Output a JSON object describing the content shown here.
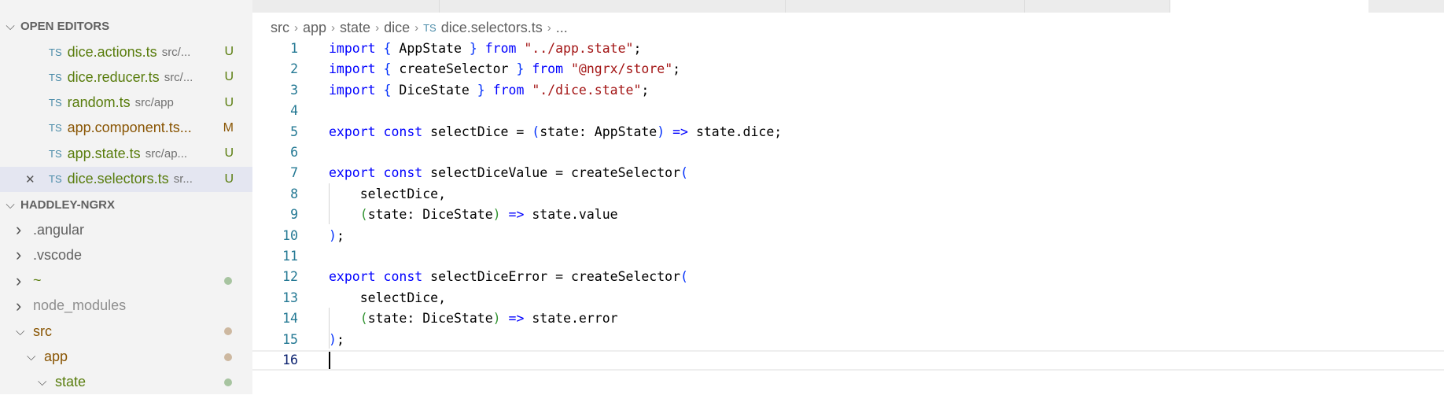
{
  "sidebar": {
    "open_editors_title": "OPEN EDITORS",
    "open_editors": [
      {
        "icon": "TS",
        "name": "dice.actions.ts",
        "desc": "src/...",
        "badge": "U",
        "color": "#587c0c"
      },
      {
        "icon": "TS",
        "name": "dice.reducer.ts",
        "desc": "src/...",
        "badge": "U",
        "color": "#587c0c"
      },
      {
        "icon": "TS",
        "name": "random.ts",
        "desc": "src/app",
        "badge": "U",
        "color": "#587c0c"
      },
      {
        "icon": "TS",
        "name": "app.component.ts...",
        "desc": "",
        "badge": "M",
        "color": "#895503"
      },
      {
        "icon": "TS",
        "name": "app.state.ts",
        "desc": "src/ap...",
        "badge": "U",
        "color": "#587c0c"
      },
      {
        "icon": "TS",
        "name": "dice.selectors.ts",
        "desc": "sr...",
        "badge": "U",
        "color": "#587c0c"
      }
    ],
    "project_title": "HADDLEY-NGRX",
    "tree": [
      {
        "name": ".angular",
        "expanded": false,
        "color": "#616161"
      },
      {
        "name": ".vscode",
        "expanded": false,
        "color": "#616161"
      },
      {
        "name": "~",
        "expanded": false,
        "color": "#587c0c",
        "dot": "#a7c4a0"
      },
      {
        "name": "node_modules",
        "expanded": false,
        "color": "#8e8e8e"
      },
      {
        "name": "src",
        "expanded": true,
        "color": "#895503",
        "dot": "#cdb8a0"
      },
      {
        "name": "app",
        "expanded": true,
        "color": "#895503",
        "dot": "#cdb8a0"
      },
      {
        "name": "state",
        "expanded": true,
        "color": "#587c0c",
        "dot": "#a7c4a0"
      }
    ]
  },
  "breadcrumb": [
    "src",
    "app",
    "state",
    "dice"
  ],
  "breadcrumb_file": "dice.selectors.ts",
  "breadcrumb_more": "...",
  "breadcrumb_file_icon": "TS",
  "code": [
    [
      [
        "import ",
        "k"
      ],
      [
        "{ ",
        "b1"
      ],
      [
        "AppState ",
        "t"
      ],
      [
        "} ",
        "b1"
      ],
      [
        "from ",
        "k"
      ],
      [
        "\"../app.state\"",
        "s"
      ],
      [
        ";",
        "t"
      ]
    ],
    [
      [
        "import ",
        "k"
      ],
      [
        "{ ",
        "b1"
      ],
      [
        "createSelector ",
        "t"
      ],
      [
        "} ",
        "b1"
      ],
      [
        "from ",
        "k"
      ],
      [
        "\"@ngrx/store\"",
        "s"
      ],
      [
        ";",
        "t"
      ]
    ],
    [
      [
        "import ",
        "k"
      ],
      [
        "{ ",
        "b1"
      ],
      [
        "DiceState ",
        "t"
      ],
      [
        "} ",
        "b1"
      ],
      [
        "from ",
        "k"
      ],
      [
        "\"./dice.state\"",
        "s"
      ],
      [
        ";",
        "t"
      ]
    ],
    [],
    [
      [
        "export ",
        "k"
      ],
      [
        "const ",
        "k"
      ],
      [
        "selectDice = ",
        "t"
      ],
      [
        "(",
        "b1"
      ],
      [
        "state: AppState",
        "t"
      ],
      [
        ")",
        "b1"
      ],
      [
        " => ",
        "k"
      ],
      [
        "state.dice;",
        "t"
      ]
    ],
    [],
    [
      [
        "export ",
        "k"
      ],
      [
        "const ",
        "k"
      ],
      [
        "selectDiceValue = createSelector",
        "t"
      ],
      [
        "(",
        "b1"
      ]
    ],
    [
      [
        "    selectDice,",
        "t"
      ]
    ],
    [
      [
        "    ",
        "t"
      ],
      [
        "(",
        "b2"
      ],
      [
        "state: DiceState",
        "t"
      ],
      [
        ")",
        "b2"
      ],
      [
        " => ",
        "k"
      ],
      [
        "state.value",
        "t"
      ]
    ],
    [
      [
        ")",
        "b1"
      ],
      [
        ";",
        "t"
      ]
    ],
    [],
    [
      [
        "export ",
        "k"
      ],
      [
        "const ",
        "k"
      ],
      [
        "selectDiceError = createSelector",
        "t"
      ],
      [
        "(",
        "b1"
      ]
    ],
    [
      [
        "    selectDice,",
        "t"
      ]
    ],
    [
      [
        "    ",
        "t"
      ],
      [
        "(",
        "b2"
      ],
      [
        "state: DiceState",
        "t"
      ],
      [
        ")",
        "b2"
      ],
      [
        " => ",
        "k"
      ],
      [
        "state.error",
        "t"
      ]
    ],
    [
      [
        ")",
        "b1"
      ],
      [
        ";",
        "t"
      ]
    ],
    []
  ],
  "current_line": 16
}
